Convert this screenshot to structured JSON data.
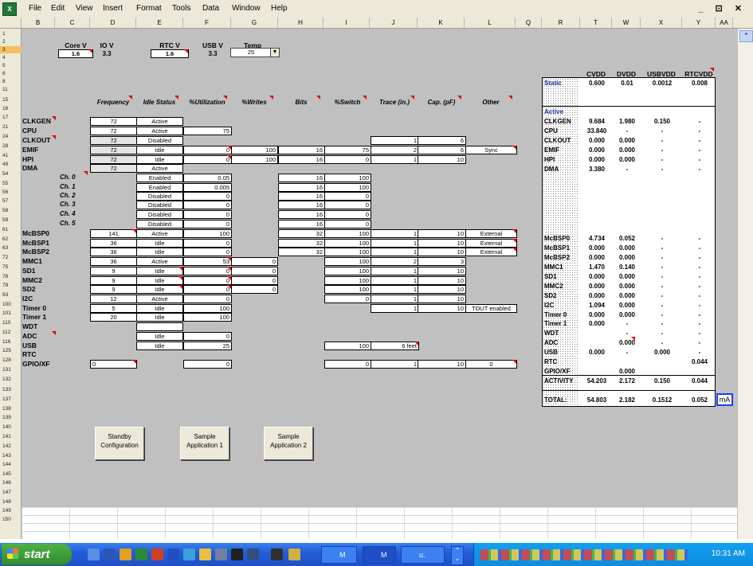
{
  "menus": [
    "File",
    "Edit",
    "View",
    "Insert",
    "Format",
    "Tools",
    "Data",
    "Window",
    "Help"
  ],
  "window_controls": "_ ⊡ ✕",
  "column_headers": [
    "B",
    "C",
    "D",
    "E",
    "F",
    "G",
    "H",
    "I",
    "J",
    "K",
    "L",
    "Q",
    "R",
    "T",
    "W",
    "X",
    "Y",
    "AA"
  ],
  "row_numbers": [
    "1",
    "2",
    "3",
    "4",
    "5",
    "6",
    "8",
    "11",
    "15",
    "16",
    "17",
    "21",
    "24",
    "28",
    "41",
    "49",
    "54",
    "55",
    "56",
    "57",
    "58",
    "59",
    "61",
    "62",
    "63",
    "72",
    "75",
    "78",
    "79",
    "93",
    "100",
    "101",
    "110",
    "112",
    "116",
    "125",
    "128",
    "131",
    "132",
    "133",
    "137",
    "138",
    "139",
    "140",
    "141",
    "142",
    "143",
    "144",
    "145",
    "146",
    "147",
    "148",
    "149",
    "150"
  ],
  "top_fields": [
    {
      "label": "Core V",
      "value": "1.6"
    },
    {
      "label": "IO V",
      "value": "3.3"
    },
    {
      "label": "RTC V",
      "value": "1.6"
    },
    {
      "label": "USB V",
      "value": "3.3"
    },
    {
      "label": "Temp",
      "value": "25"
    }
  ],
  "table_headers": [
    "Frequency",
    "Idle Status",
    "%Utilization",
    "%Writes",
    "Bits",
    "%Switch",
    "Trace (in.)",
    "Cap. (pF)",
    "Other"
  ],
  "rows": [
    {
      "label": "CLKGEN",
      "freq": "72",
      "idle": "Active",
      "util": "",
      "writes": "",
      "bits": "",
      "sw": "",
      "trace": "",
      "cap": "",
      "other": ""
    },
    {
      "label": "CPU",
      "freq": "72",
      "idle": "Active",
      "util": "75",
      "writes": "",
      "bits": "",
      "sw": "",
      "trace": "",
      "cap": "",
      "other": ""
    },
    {
      "label": "CLKOUT",
      "freq": "72",
      "idle": "Disabled",
      "util": "",
      "writes": "",
      "bits": "",
      "sw": "",
      "trace": "1",
      "cap": "6",
      "other": ""
    },
    {
      "label": "EMIF",
      "freq": "72",
      "idle": "Idle",
      "util": "0",
      "writes": "100",
      "bits": "16",
      "sw": "75",
      "trace": "2",
      "cap": "6",
      "other": "Sync"
    },
    {
      "label": "HPI",
      "freq": "72",
      "idle": "Idle",
      "util": "0",
      "writes": "100",
      "bits": "16",
      "sw": "0",
      "trace": "1",
      "cap": "10",
      "other": ""
    },
    {
      "label": "DMA",
      "freq": "72",
      "idle": "Active",
      "util": "",
      "writes": "",
      "bits": "",
      "sw": "",
      "trace": "",
      "cap": "",
      "other": ""
    },
    {
      "label": "Ch. 0",
      "freq": "",
      "idle": "Enabled",
      "util": "0.05",
      "writes": "",
      "bits": "16",
      "sw": "100",
      "trace": "",
      "cap": "",
      "other": ""
    },
    {
      "label": "Ch. 1",
      "freq": "",
      "idle": "Enabled",
      "util": "0.005",
      "writes": "",
      "bits": "16",
      "sw": "100",
      "trace": "",
      "cap": "",
      "other": ""
    },
    {
      "label": "Ch. 2",
      "freq": "",
      "idle": "Disabled",
      "util": "0",
      "writes": "",
      "bits": "16",
      "sw": "0",
      "trace": "",
      "cap": "",
      "other": ""
    },
    {
      "label": "Ch. 3",
      "freq": "",
      "idle": "Disabled",
      "util": "0",
      "writes": "",
      "bits": "16",
      "sw": "0",
      "trace": "",
      "cap": "",
      "other": ""
    },
    {
      "label": "Ch. 4",
      "freq": "",
      "idle": "Disabled",
      "util": "0",
      "writes": "",
      "bits": "16",
      "sw": "0",
      "trace": "",
      "cap": "",
      "other": ""
    },
    {
      "label": "Ch. 5",
      "freq": "",
      "idle": "Disabled",
      "util": "0",
      "writes": "",
      "bits": "16",
      "sw": "0",
      "trace": "",
      "cap": "",
      "other": ""
    },
    {
      "label": "McBSP0",
      "freq": "141",
      "idle": "Active",
      "util": "100",
      "writes": "",
      "bits": "32",
      "sw": "100",
      "trace": "1",
      "cap": "10",
      "other": "External"
    },
    {
      "label": "McBSP1",
      "freq": "36",
      "idle": "Idle",
      "util": "0",
      "writes": "",
      "bits": "32",
      "sw": "100",
      "trace": "1",
      "cap": "10",
      "other": "External"
    },
    {
      "label": "McBSP2",
      "freq": "36",
      "idle": "Idle",
      "util": "0",
      "writes": "",
      "bits": "32",
      "sw": "100",
      "trace": "1",
      "cap": "10",
      "other": "External"
    },
    {
      "label": "MMC1",
      "freq": "36",
      "idle": "Active",
      "util": "53",
      "writes": "0",
      "bits": "",
      "sw": "100",
      "trace": "2",
      "cap": "3",
      "other": ""
    },
    {
      "label": "SD1",
      "freq": "9",
      "idle": "Idle",
      "util": "0",
      "writes": "0",
      "bits": "",
      "sw": "100",
      "trace": "1",
      "cap": "10",
      "other": ""
    },
    {
      "label": "MMC2",
      "freq": "9",
      "idle": "Idle",
      "util": "0",
      "writes": "0",
      "bits": "",
      "sw": "100",
      "trace": "1",
      "cap": "10",
      "other": ""
    },
    {
      "label": "SD2",
      "freq": "9",
      "idle": "Idle",
      "util": "0",
      "writes": "0",
      "bits": "",
      "sw": "100",
      "trace": "1",
      "cap": "10",
      "other": ""
    },
    {
      "label": "I2C",
      "freq": "12",
      "idle": "Active",
      "util": "0",
      "writes": "",
      "bits": "",
      "sw": "0",
      "trace": "1",
      "cap": "10",
      "other": ""
    },
    {
      "label": "Timer 0",
      "freq": "5",
      "idle": "Idle",
      "util": "100",
      "writes": "",
      "bits": "",
      "sw": "",
      "trace": "1",
      "cap": "10",
      "other": "TOUT enabled"
    },
    {
      "label": "Timer 1",
      "freq": "20",
      "idle": "Idle",
      "util": "100",
      "writes": "",
      "bits": "",
      "sw": "",
      "trace": "",
      "cap": "",
      "other": ""
    },
    {
      "label": "WDT",
      "freq": "",
      "idle": "",
      "util": "",
      "writes": "",
      "bits": "",
      "sw": "",
      "trace": "",
      "cap": "",
      "other": ""
    },
    {
      "label": "ADC",
      "freq": "",
      "idle": "Idle",
      "util": "0",
      "writes": "",
      "bits": "",
      "sw": "",
      "trace": "",
      "cap": "",
      "other": ""
    },
    {
      "label": "USB",
      "freq": "",
      "idle": "Idle",
      "util": "25",
      "writes": "",
      "bits": "",
      "sw": "100",
      "trace": "6 feet",
      "cap": "",
      "other": ""
    },
    {
      "label": "RTC",
      "freq": "",
      "idle": "",
      "util": "",
      "writes": "",
      "bits": "",
      "sw": "",
      "trace": "",
      "cap": "",
      "other": ""
    },
    {
      "label": "GPIO/XF",
      "freq": "0",
      "idle": "",
      "util": "0",
      "writes": "",
      "bits": "",
      "sw": "0",
      "trace": "1",
      "cap": "10",
      "other": "0"
    }
  ],
  "buttons": [
    {
      "line1": "Standby",
      "line2": "Configuration"
    },
    {
      "line1": "Sample",
      "line2": "Application 1"
    },
    {
      "line1": "Sample",
      "line2": "Application 2"
    }
  ],
  "results": {
    "headers": [
      "CVDD",
      "DVDD",
      "USBVDD",
      "RTCVDD"
    ],
    "static": {
      "label": "Static",
      "v": [
        "0.600",
        "0.01",
        "0.0012",
        "0.008"
      ]
    },
    "active_label": "Active",
    "rows": [
      {
        "label": "CLKGEN",
        "v": [
          "9.684",
          "1.980",
          "0.150",
          "-"
        ]
      },
      {
        "label": "CPU",
        "v": [
          "33.840",
          "-",
          "-",
          "-"
        ]
      },
      {
        "label": "CLKOUT",
        "v": [
          "0.000",
          "0.000",
          "-",
          "-"
        ]
      },
      {
        "label": "EMIF",
        "v": [
          "0.000",
          "0.000",
          "-",
          "-"
        ]
      },
      {
        "label": "HPI",
        "v": [
          "0.000",
          "0.000",
          "-",
          "-"
        ]
      },
      {
        "label": "DMA",
        "v": [
          "3.380",
          "-",
          "-",
          "-"
        ]
      },
      {
        "label": "McBSP0",
        "v": [
          "4.734",
          "0.052",
          "-",
          "-"
        ]
      },
      {
        "label": "McBSP1",
        "v": [
          "0.000",
          "0.000",
          "-",
          "-"
        ]
      },
      {
        "label": "McBSP2",
        "v": [
          "0.000",
          "0.000",
          "-",
          "-"
        ]
      },
      {
        "label": "MMC1",
        "v": [
          "1.470",
          "0.140",
          "-",
          "-"
        ]
      },
      {
        "label": "SD1",
        "v": [
          "0.000",
          "0.000",
          "-",
          "-"
        ]
      },
      {
        "label": "MMC2",
        "v": [
          "0.000",
          "0.000",
          "-",
          "-"
        ]
      },
      {
        "label": "SD2",
        "v": [
          "0.000",
          "0.000",
          "-",
          "-"
        ]
      },
      {
        "label": "I2C",
        "v": [
          "1.094",
          "0.000",
          "-",
          "-"
        ]
      },
      {
        "label": "Timer 0",
        "v": [
          "0.000",
          "0.000",
          "-",
          "-"
        ]
      },
      {
        "label": "Timer 1",
        "v": [
          "0.000",
          "-",
          "-",
          "-"
        ]
      },
      {
        "label": "WDT",
        "v": [
          "",
          "-",
          "-",
          "-"
        ]
      },
      {
        "label": "ADC",
        "v": [
          "",
          "0.000",
          "-",
          "-"
        ]
      },
      {
        "label": "USB",
        "v": [
          "0.000",
          "-",
          "0.000",
          "-"
        ]
      },
      {
        "label": "RTC",
        "v": [
          "",
          "",
          "",
          "0.044"
        ]
      },
      {
        "label": "GPIO/XF",
        "v": [
          "",
          "0.000",
          "",
          ""
        ]
      }
    ],
    "activity": {
      "label": "ACTIVITY",
      "v": [
        "54.203",
        "2.172",
        "0.150",
        "0.044"
      ]
    },
    "total": {
      "label": "TOTAL:",
      "v": [
        "54.803",
        "2.182",
        "0.1512",
        "0.052"
      ]
    },
    "unit": "mA"
  },
  "taskbar": {
    "start": "start",
    "tasks": [
      "M",
      "M",
      "u."
    ],
    "clock": "10:31 AM"
  }
}
